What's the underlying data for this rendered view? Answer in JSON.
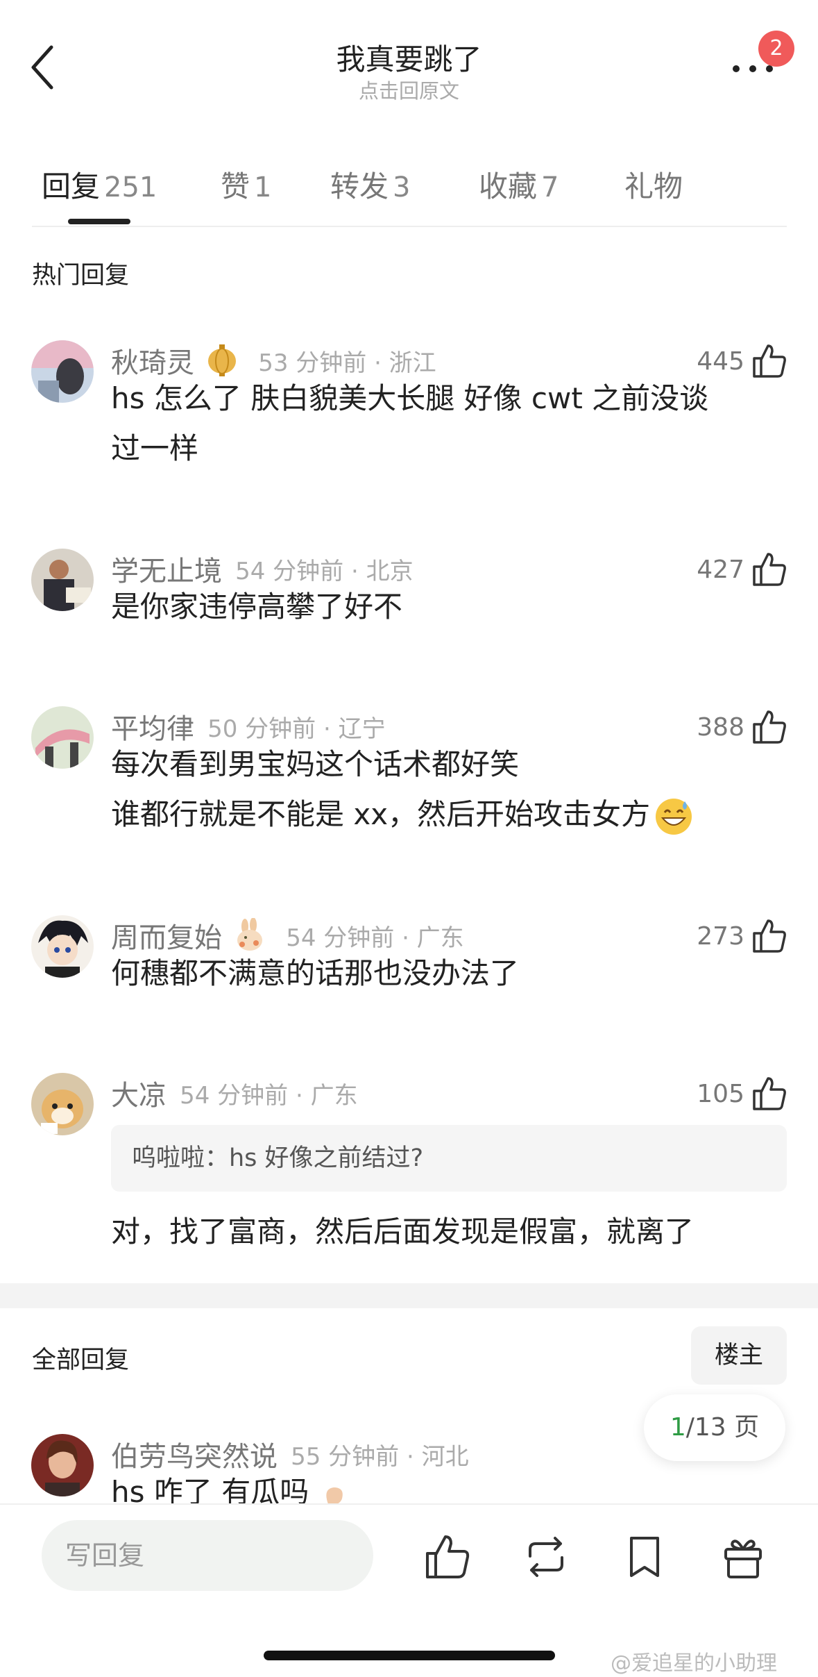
{
  "header": {
    "title": "我真要跳了",
    "subtitle": "点击回原文",
    "notification_count": "2"
  },
  "tabs": [
    {
      "label": "回复",
      "count": "251"
    },
    {
      "label": "赞",
      "count": "1"
    },
    {
      "label": "转发",
      "count": "3"
    },
    {
      "label": "收藏",
      "count": "7"
    },
    {
      "label": "礼物",
      "count": ""
    }
  ],
  "hot_section": {
    "title": "热门回复",
    "comments": [
      {
        "user": "秋琦灵",
        "badge": "lantern-badge",
        "time": "53 分钟前 · 浙江",
        "likes": "445",
        "lines": [
          "hs 怎么了 肤白貌美大长腿 好像 cwt 之前没谈",
          "过一样"
        ]
      },
      {
        "user": "学无止境",
        "time": "54 分钟前 · 北京",
        "likes": "427",
        "lines": [
          "是你家违停高攀了好不"
        ]
      },
      {
        "user": "平均律",
        "time": "50 分钟前 · 辽宁",
        "likes": "388",
        "lines": [
          "每次看到男宝妈这个话术都好笑",
          "谁都行就是不能是 xx，然后开始攻击女方"
        ]
      },
      {
        "user": "周而复始",
        "badge": "rabbit-badge",
        "time": "54 分钟前 · 广东",
        "likes": "273",
        "lines": [
          "何穗都不满意的话那也没办法了"
        ]
      },
      {
        "user": "大凉",
        "time": "54 分钟前 · 广东",
        "likes": "105",
        "quote": "呜啦啦：hs 好像之前结过?",
        "lines": [
          "对，找了富商，然后后面发现是假富，就离了"
        ]
      }
    ]
  },
  "all_section": {
    "title": "全部回复",
    "owner_filter": "楼主",
    "page_current": "1",
    "page_total": "/13 页",
    "comments": [
      {
        "user": "伯劳鸟突然说",
        "time": "55 分钟前 · 河北",
        "likes": "",
        "lines": [
          "hs 咋了 有瓜吗"
        ]
      }
    ]
  },
  "bottom_bar": {
    "reply_placeholder": "写回复"
  },
  "watermark": "@爱追星的小助理",
  "colors": {
    "badge_red": "#f05a5a",
    "page_green": "#2e9b44",
    "input_bg": "#f1f3f1"
  }
}
